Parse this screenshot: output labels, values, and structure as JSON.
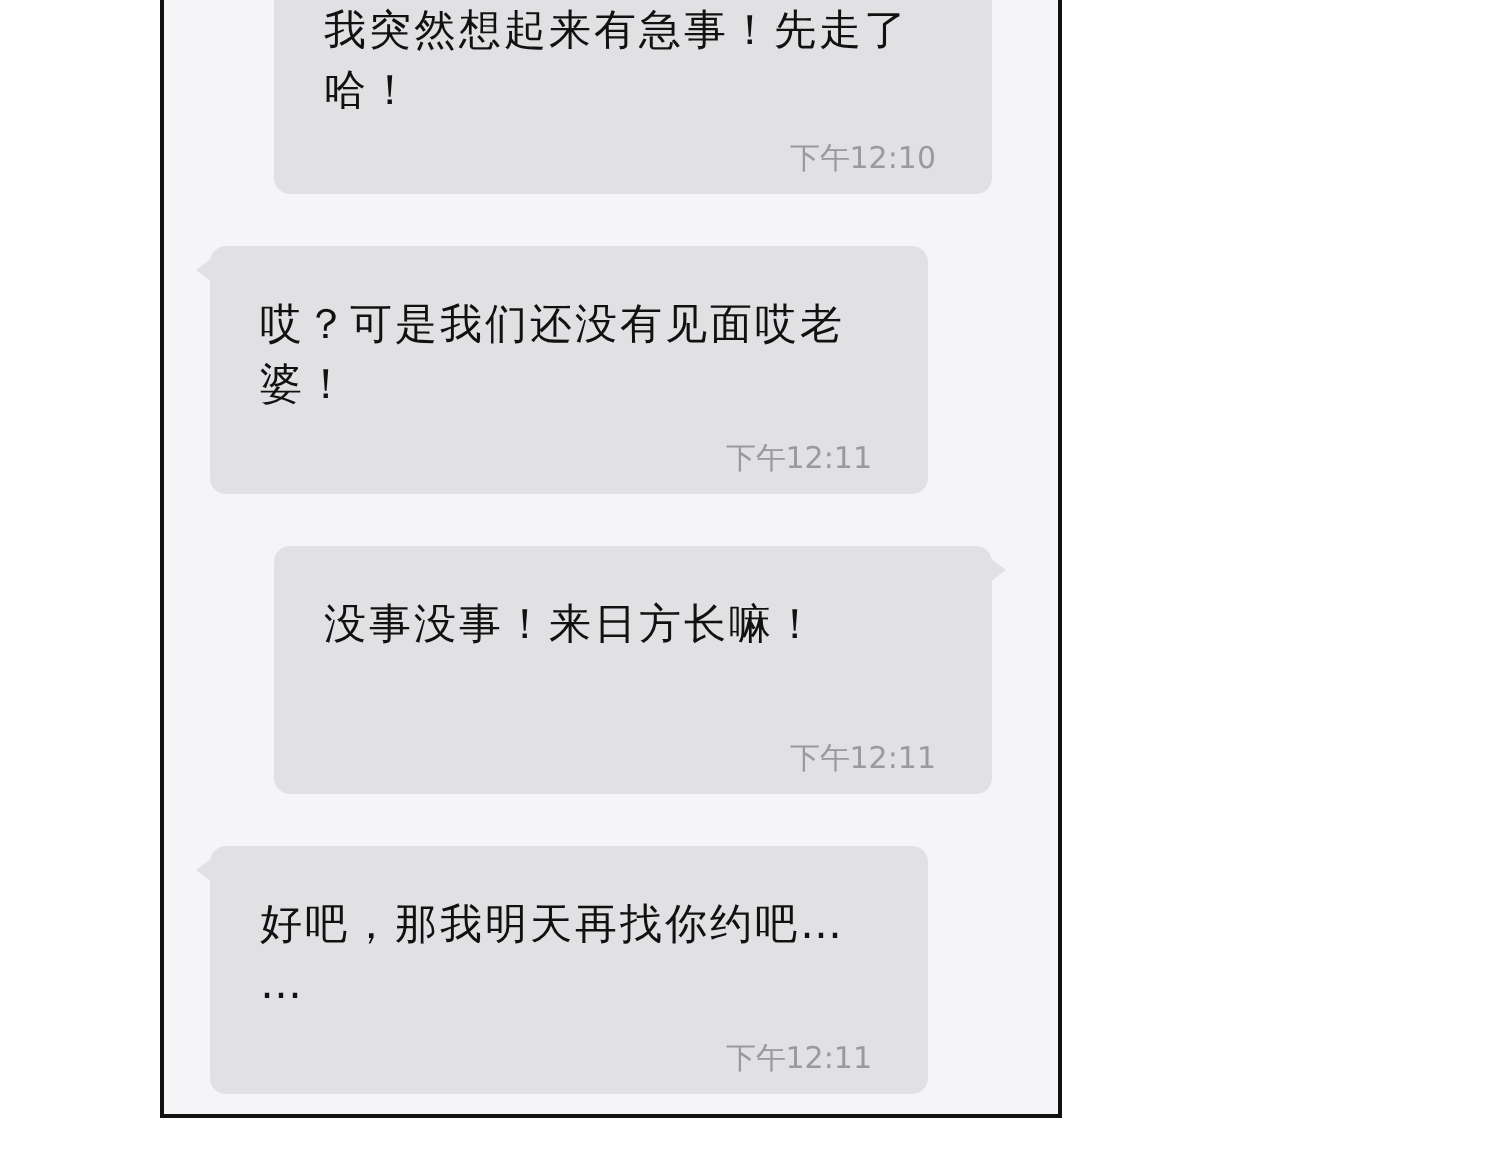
{
  "messages": [
    {
      "kind": "outgoing",
      "text": "我突然想起来有急事！先走了哈！",
      "time": "下午12:10"
    },
    {
      "kind": "incoming",
      "text": "哎？可是我们还没有见面哎老婆！",
      "time": "下午12:11"
    },
    {
      "kind": "outgoing",
      "text": "没事没事！来日方长嘛！",
      "time": "下午12:11"
    },
    {
      "kind": "incoming",
      "text": "好吧，那我明天再找你约吧……",
      "time": "下午12:11"
    }
  ]
}
